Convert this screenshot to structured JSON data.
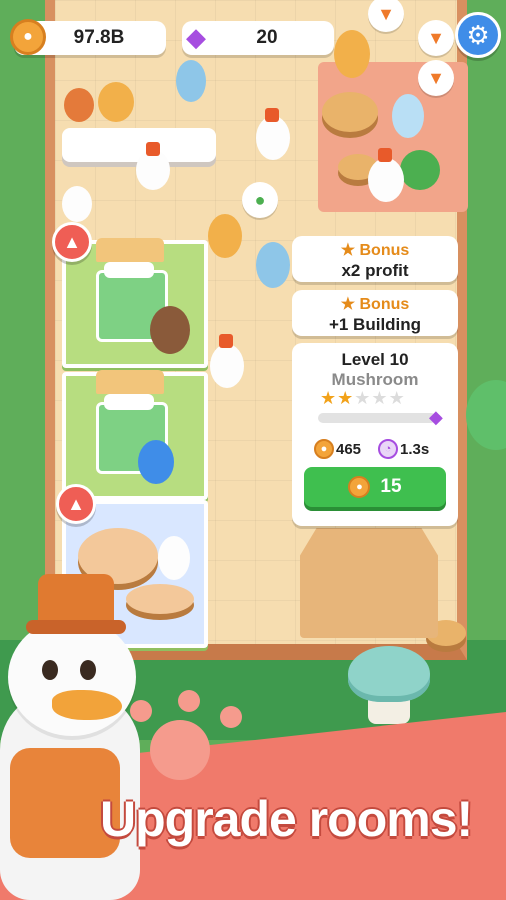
{
  "hud": {
    "coins": "97.8B",
    "gems": "20"
  },
  "icons": {
    "coin": "paw-coin-icon",
    "gem": "gem-icon",
    "settings": "gear-icon",
    "carrot": "carrot-icon",
    "upgrade": "up-arrow-icon"
  },
  "bonus_1": {
    "title": "Bonus",
    "value": "x2 profit"
  },
  "bonus_2": {
    "title": "Bonus",
    "value": "+1 Building"
  },
  "upgrade_panel": {
    "level": "Level 10",
    "name": "Mushroom",
    "stars_filled": 2,
    "stars_total": 5,
    "progress": 0.0,
    "income": "465",
    "time": "1.3s",
    "cost": "15"
  },
  "promo": {
    "headline": "Upgrade rooms!"
  },
  "colors": {
    "coin": "#f3a43a",
    "gem": "#a64de0",
    "button_green": "#3fbf4f",
    "bonus_orange": "#e58b1a",
    "promo_red": "#f07a6b",
    "settings_blue": "#3f8de8"
  }
}
